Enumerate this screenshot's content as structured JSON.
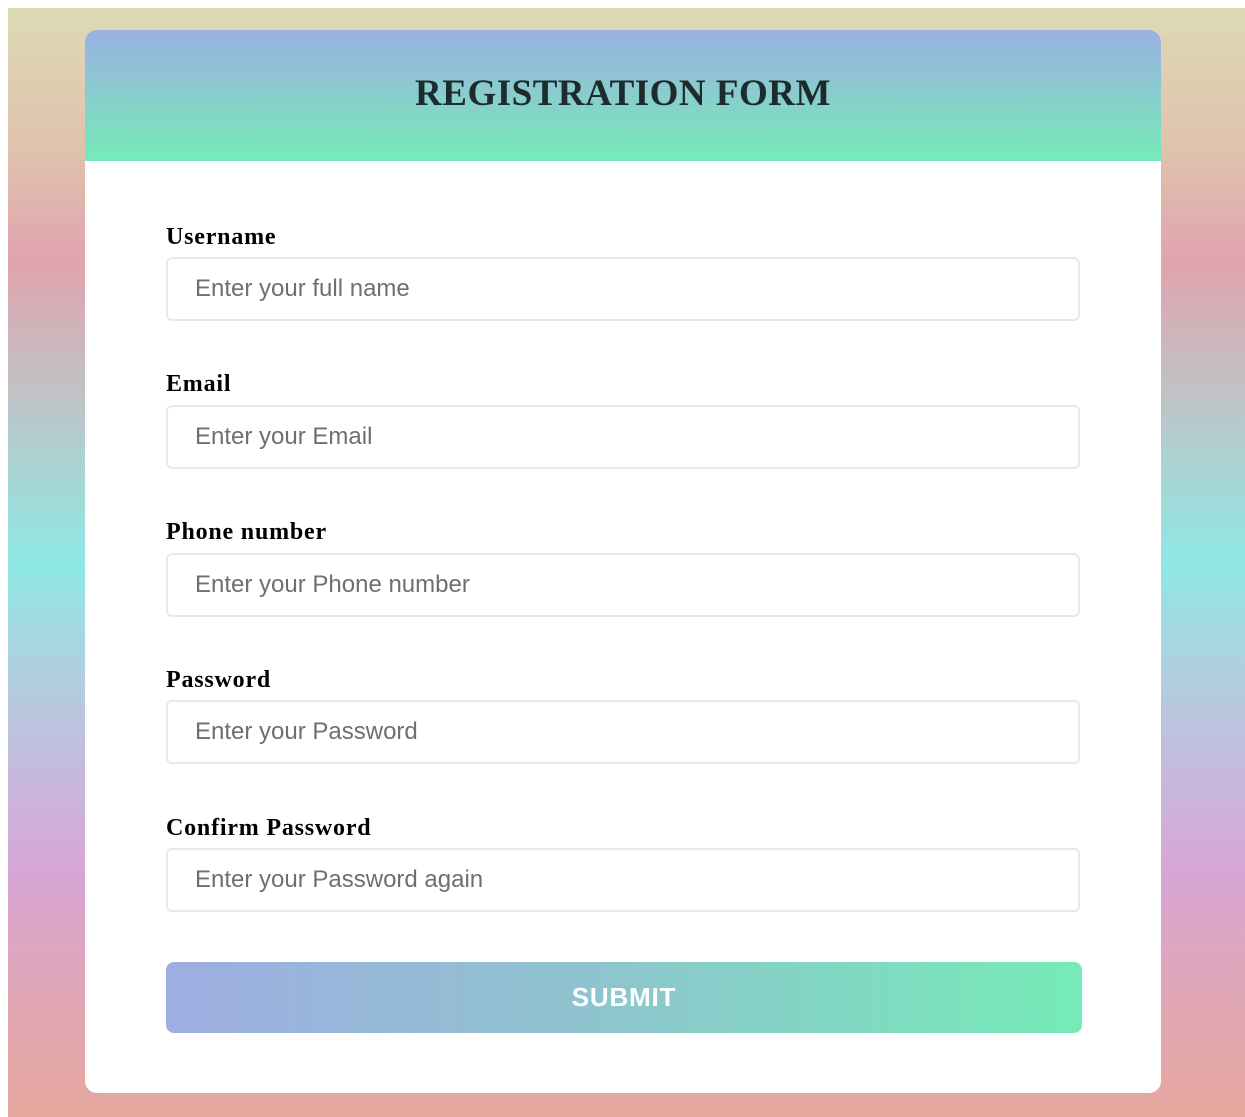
{
  "form": {
    "title": "REGISTRATION FORM",
    "fields": [
      {
        "label": "Username",
        "placeholder": "Enter your full name"
      },
      {
        "label": "Email",
        "placeholder": "Enter your Email"
      },
      {
        "label": "Phone number",
        "placeholder": "Enter your Phone number"
      },
      {
        "label": "Password",
        "placeholder": "Enter your Password"
      },
      {
        "label": "Confirm Password",
        "placeholder": "Enter your Password again"
      }
    ],
    "submit_label": "SUBMIT"
  },
  "colors": {
    "header_gradient_top": "#9bb0e2",
    "header_gradient_bottom": "#75ebb7",
    "button_gradient_left": "#9eade2",
    "button_gradient_right": "#75ebb7",
    "title_text": "#1e2b2c",
    "card_background": "#ffffff"
  }
}
